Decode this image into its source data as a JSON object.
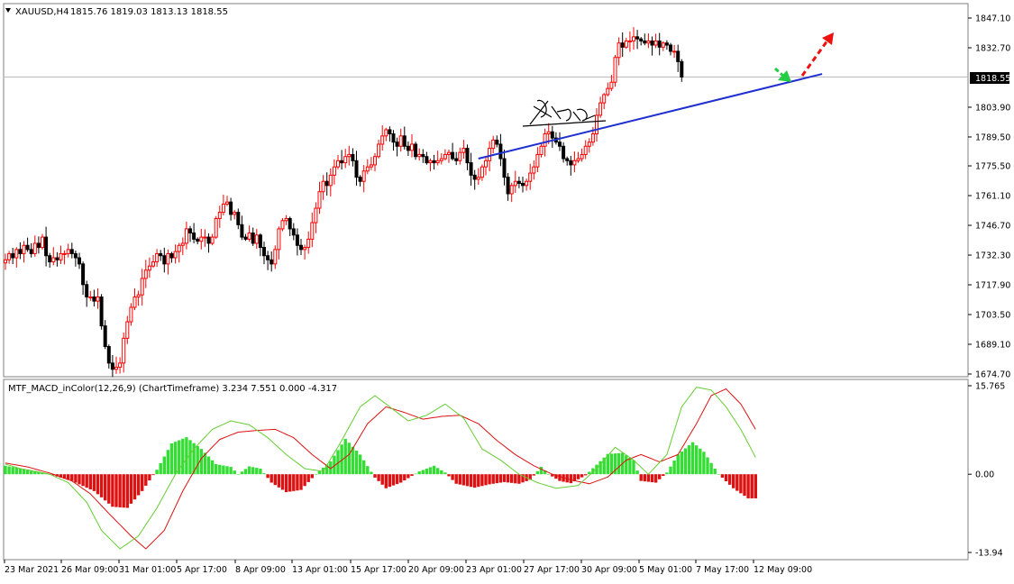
{
  "chart_title": {
    "symbol": "XAUUSD,H4",
    "ohlc": "1815.76 1819.03 1813.13 1818.55"
  },
  "indicator_title": "MTF_MACD_inColor(12,26,9) (ChartTimeframe) 3.234 7.551 0.000 -4.317",
  "current_price_label": "1818.55",
  "colors": {
    "bull": "#ff0000",
    "bear": "#000000",
    "trend_line": "#1f2fd0",
    "hist_up": "#33dd33",
    "hist_down": "#dd1111",
    "macd_line": "#66cc33",
    "signal_line": "#dd1111",
    "arrow_down": "#22cc44",
    "arrow_up": "#ee1111"
  },
  "chart_data": [
    {
      "type": "candlestick",
      "symbol": "XAUUSD",
      "timeframe": "H4",
      "ylim": [
        1674.7,
        1847.1
      ],
      "y_ticks": [
        "1847.10",
        "1832.70",
        "1818.55",
        "1803.90",
        "1789.50",
        "1775.50",
        "1761.10",
        "1746.70",
        "1732.30",
        "1717.90",
        "1703.50",
        "1689.10",
        "1674.70"
      ],
      "x_ticks": [
        "23 Mar 2021",
        "26 Mar 09:00",
        "31 Mar 01:00",
        "5 Apr 17:00",
        "8 Apr 09:00",
        "13 Apr 01:00",
        "15 Apr 17:00",
        "20 Apr 09:00",
        "23 Apr 01:00",
        "27 Apr 17:00",
        "30 Apr 09:00",
        "5 May 01:00",
        "7 May 17:00",
        "12 May 09:00"
      ],
      "grid": false,
      "current_price": 1818.55,
      "closes": [
        1730,
        1733,
        1731,
        1735,
        1733,
        1737,
        1735,
        1733,
        1738,
        1736,
        1741,
        1732,
        1729,
        1731,
        1730,
        1733,
        1733,
        1735,
        1733,
        1731,
        1728,
        1718,
        1712,
        1712,
        1710,
        1712,
        1698,
        1688,
        1680,
        1677,
        1678,
        1680,
        1692,
        1700,
        1707,
        1712,
        1713,
        1721,
        1725,
        1727,
        1729,
        1733,
        1732,
        1728,
        1733,
        1731,
        1734,
        1737,
        1738,
        1745,
        1743,
        1740,
        1739,
        1741,
        1741,
        1738,
        1741,
        1750,
        1753,
        1757,
        1758,
        1752,
        1753,
        1747,
        1741,
        1740,
        1743,
        1738,
        1742,
        1736,
        1732,
        1730,
        1728,
        1735,
        1745,
        1749,
        1750,
        1745,
        1742,
        1737,
        1735,
        1736,
        1740,
        1748,
        1755,
        1763,
        1768,
        1766,
        1771,
        1775,
        1778,
        1777,
        1780,
        1781,
        1778,
        1770,
        1768,
        1773,
        1775,
        1776,
        1780,
        1786,
        1790,
        1793,
        1791,
        1787,
        1785,
        1790,
        1785,
        1783,
        1786,
        1780,
        1781,
        1780,
        1777,
        1778,
        1777,
        1778,
        1779,
        1781,
        1782,
        1779,
        1778,
        1782,
        1784,
        1777,
        1771,
        1769,
        1770,
        1775,
        1778,
        1784,
        1788,
        1786,
        1779,
        1770,
        1762,
        1766,
        1768,
        1767,
        1766,
        1768,
        1772,
        1775,
        1781,
        1785,
        1791,
        1792,
        1789,
        1787,
        1785,
        1779,
        1778,
        1776,
        1778,
        1779,
        1781,
        1785,
        1787,
        1791,
        1800,
        1806,
        1810,
        1813,
        1816,
        1828,
        1835,
        1833,
        1836,
        1836,
        1838,
        1837,
        1836,
        1835,
        1836,
        1834,
        1836,
        1833,
        1835,
        1834,
        1831,
        1831,
        1826,
        1818.55
      ],
      "trend_line": {
        "from": {
          "candle": 128,
          "price": 1779
        },
        "to": {
          "candle": 221,
          "price": 1820
        }
      },
      "annotations": [
        {
          "type": "arrow",
          "direction": "down",
          "style": "dashed",
          "color_key": "arrow_down"
        },
        {
          "type": "arrow",
          "direction": "up",
          "style": "dashed",
          "color_key": "arrow_up"
        },
        {
          "type": "signature"
        }
      ]
    },
    {
      "type": "macd_histogram",
      "name": "MTF_MACD_inColor(12,26,9)",
      "ylim": [
        -13.94,
        15.765
      ],
      "y_ticks": [
        "15.765",
        "0.00",
        "-13.94"
      ],
      "values": [
        3.234,
        7.551,
        0.0,
        -4.317
      ],
      "macd_shape": [
        [
          0,
          1.8
        ],
        [
          4,
          1.0
        ],
        [
          8,
          0.5
        ],
        [
          12,
          0.0
        ],
        [
          17,
          -1.5
        ],
        [
          22,
          -5
        ],
        [
          26,
          -10
        ],
        [
          31,
          -13.3
        ],
        [
          36,
          -11
        ],
        [
          41,
          -6
        ],
        [
          46,
          0
        ],
        [
          51,
          4.5
        ],
        [
          56,
          8
        ],
        [
          61,
          9.5
        ],
        [
          66,
          8.8
        ],
        [
          71,
          6.5
        ],
        [
          76,
          3.5
        ],
        [
          81,
          1.0
        ],
        [
          86,
          0.5
        ],
        [
          91,
          6
        ],
        [
          96,
          12
        ],
        [
          100,
          14
        ],
        [
          104,
          12
        ],
        [
          109,
          9.5
        ],
        [
          114,
          10.5
        ],
        [
          119,
          12.5
        ],
        [
          124,
          10
        ],
        [
          129,
          4.5
        ],
        [
          134,
          2.5
        ],
        [
          139,
          0.0
        ],
        [
          144,
          -1.5
        ],
        [
          149,
          -2.5
        ],
        [
          155,
          -2.0
        ],
        [
          160,
          1.0
        ],
        [
          165,
          4.8
        ],
        [
          170,
          2.5
        ],
        [
          174,
          0.0
        ],
        [
          179,
          3.5
        ],
        [
          183,
          12
        ],
        [
          187,
          15.5
        ],
        [
          191,
          15
        ],
        [
          195,
          12
        ],
        [
          199,
          8
        ],
        [
          203,
          3
        ]
      ],
      "signal_shape": [
        [
          0,
          2.0
        ],
        [
          6,
          1.3
        ],
        [
          12,
          0.2
        ],
        [
          18,
          -1.2
        ],
        [
          23,
          -3.5
        ],
        [
          28,
          -7
        ],
        [
          34,
          -11
        ],
        [
          38,
          -13.3
        ],
        [
          43,
          -10
        ],
        [
          48,
          -3
        ],
        [
          53,
          2.8
        ],
        [
          58,
          6.2
        ],
        [
          63,
          7.5
        ],
        [
          68,
          7.8
        ],
        [
          73,
          8
        ],
        [
          78,
          6.5
        ],
        [
          83,
          3.5
        ],
        [
          88,
          1.0
        ],
        [
          93,
          3.5
        ],
        [
          98,
          9
        ],
        [
          103,
          12
        ],
        [
          108,
          11
        ],
        [
          113,
          9.8
        ],
        [
          118,
          10.3
        ],
        [
          123,
          10.5
        ],
        [
          128,
          9
        ],
        [
          133,
          6
        ],
        [
          138,
          3.5
        ],
        [
          143,
          1.5
        ],
        [
          148,
          0.0
        ],
        [
          153,
          -1.0
        ],
        [
          158,
          -1.7
        ],
        [
          163,
          -0.5
        ],
        [
          168,
          2.5
        ],
        [
          172,
          3.5
        ],
        [
          177,
          2.2
        ],
        [
          182,
          3.5
        ],
        [
          187,
          9
        ],
        [
          191,
          14
        ],
        [
          195,
          15.2
        ],
        [
          199,
          12.5
        ],
        [
          203,
          8
        ]
      ],
      "hist_shape": [
        [
          0,
          1.5
        ],
        [
          8,
          0.6
        ],
        [
          12,
          0.0
        ],
        [
          18,
          -1.2
        ],
        [
          24,
          -3
        ],
        [
          29,
          -5.8
        ],
        [
          33,
          -6.0
        ],
        [
          37,
          -3
        ],
        [
          41,
          0.8
        ],
        [
          45,
          5.5
        ],
        [
          49,
          6.6
        ],
        [
          53,
          4.5
        ],
        [
          57,
          1.8
        ],
        [
          61,
          1.3
        ],
        [
          63,
          0.0
        ],
        [
          66,
          1.4
        ],
        [
          69,
          1.0
        ],
        [
          72,
          -1.5
        ],
        [
          76,
          -3.2
        ],
        [
          80,
          -2.8
        ],
        [
          84,
          0.0
        ],
        [
          88,
          2.3
        ],
        [
          92,
          6.3
        ],
        [
          96,
          3.5
        ],
        [
          100,
          -0.6
        ],
        [
          103,
          -2.5
        ],
        [
          107,
          -1.5
        ],
        [
          112,
          0.5
        ],
        [
          116,
          1.5
        ],
        [
          119,
          0.3
        ],
        [
          122,
          -1.7
        ],
        [
          127,
          -2.4
        ],
        [
          131,
          -1.8
        ],
        [
          135,
          -1.4
        ],
        [
          139,
          -1.7
        ],
        [
          142,
          -1.0
        ],
        [
          145,
          1.3
        ],
        [
          147,
          0.0
        ],
        [
          150,
          -1.2
        ],
        [
          153,
          -1.6
        ],
        [
          157,
          -0.2
        ],
        [
          160,
          1.7
        ],
        [
          163,
          3.6
        ],
        [
          167,
          3.8
        ],
        [
          170,
          2.5
        ],
        [
          172,
          -1.2
        ],
        [
          176,
          -1.5
        ],
        [
          179,
          0.3
        ],
        [
          182,
          3.5
        ],
        [
          186,
          5.7
        ],
        [
          189,
          4
        ],
        [
          193,
          0.0
        ],
        [
          197,
          -2.5
        ],
        [
          201,
          -4.3
        ],
        [
          203,
          -4.3
        ]
      ]
    }
  ]
}
